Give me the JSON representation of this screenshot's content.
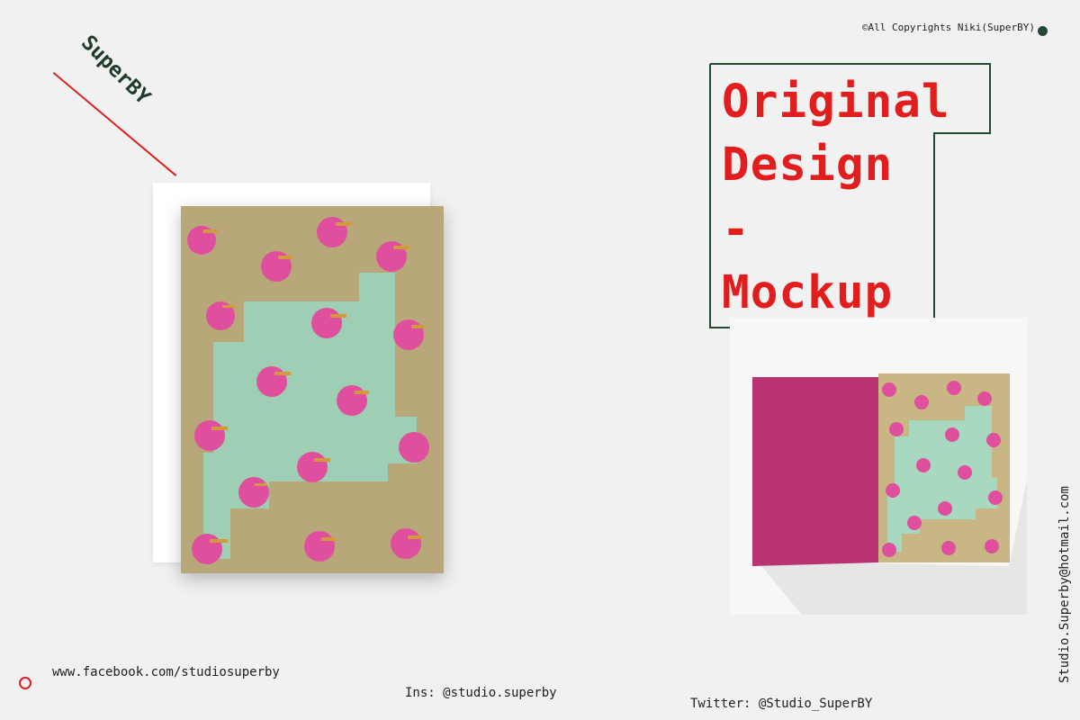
{
  "brand": {
    "logo_text": "SuperBY"
  },
  "copyright": "©All Copyrights Niki(SuperBY)",
  "title": {
    "lines": [
      "Original",
      "Design",
      "-",
      "Mockup"
    ]
  },
  "footer": {
    "facebook": "www.facebook.com/studiosuperby",
    "instagram": "Ins: @studio.superby",
    "twitter": "Twitter: @Studio_SuperBY",
    "email": "Studio.Superby@hotmail.com"
  },
  "colors": {
    "accent_red": "#e21d1d",
    "dark_green": "#224a33",
    "card_tan": "#b8a778",
    "card_mint": "#9ecfb4",
    "dot_pink": "#df4f9d",
    "card_back": "#b8336f"
  }
}
